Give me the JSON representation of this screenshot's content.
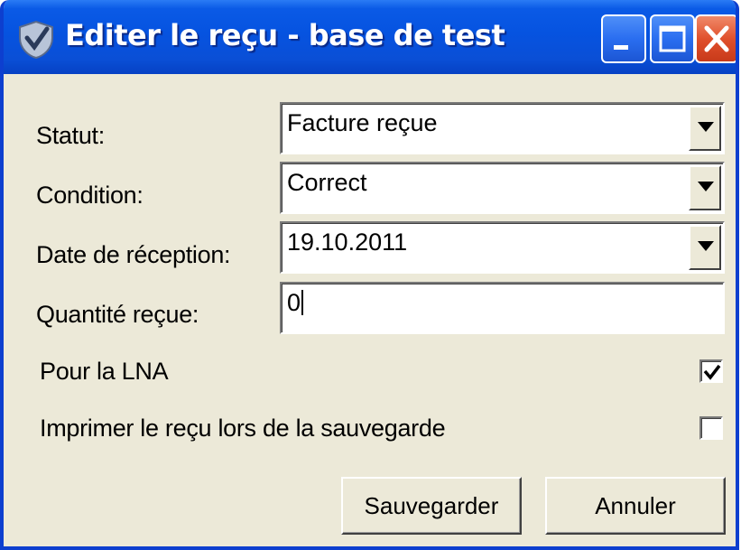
{
  "window": {
    "title": "Editer le reçu - base de test",
    "icon": "checkmark-shield-icon",
    "controls": [
      "minimize-icon",
      "maximize-icon",
      "close-icon"
    ]
  },
  "form": {
    "status": {
      "label": "Statut:",
      "value": "Facture reçue"
    },
    "condition": {
      "label": "Condition:",
      "value": "Correct"
    },
    "reception_date": {
      "label": "Date de réception:",
      "value": "19.10.2011"
    },
    "quantity": {
      "label": "Quantité reçue:",
      "value": "0"
    },
    "for_lna": {
      "label": "Pour la LNA",
      "checked": true
    },
    "print_receipt": {
      "label": "Imprimer le reçu lors de la sauvegarde",
      "checked": false
    }
  },
  "buttons": {
    "save": "Sauvegarder",
    "cancel": "Annuler"
  },
  "colors": {
    "titlebar": "#0653e0",
    "window_background": "#ece9d8",
    "close_button": "#e0502c"
  }
}
